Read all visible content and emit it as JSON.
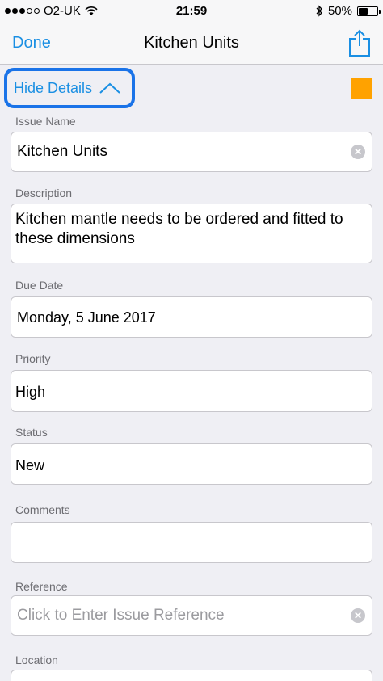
{
  "status_bar": {
    "carrier": "O2-UK",
    "time": "21:59",
    "battery": "50%",
    "battery_level": 0.5,
    "signal_bars": 3,
    "signal_total": 5
  },
  "nav": {
    "done_label": "Done",
    "title": "Kitchen Units",
    "share_icon": "share-icon"
  },
  "details_toggle": {
    "label": "Hide Details",
    "icon": "chevron-up-icon"
  },
  "swatch_color": "#ffa200",
  "fields": {
    "issue_name": {
      "label": "Issue Name",
      "value": "Kitchen Units"
    },
    "description": {
      "label": "Description",
      "value": "Kitchen mantle needs to be ordered and fitted to these dimensions"
    },
    "due_date": {
      "label": "Due Date",
      "value": "Monday, 5 June 2017"
    },
    "priority": {
      "label": "Priority",
      "value": "High"
    },
    "status": {
      "label": "Status",
      "value": "New"
    },
    "comments": {
      "label": "Comments",
      "value": ""
    },
    "reference": {
      "label": "Reference",
      "placeholder": "Click to Enter Issue Reference"
    },
    "location": {
      "label": "Location"
    }
  },
  "colors": {
    "accent": "#1a8fe3",
    "highlight_border": "#1a73e8"
  }
}
